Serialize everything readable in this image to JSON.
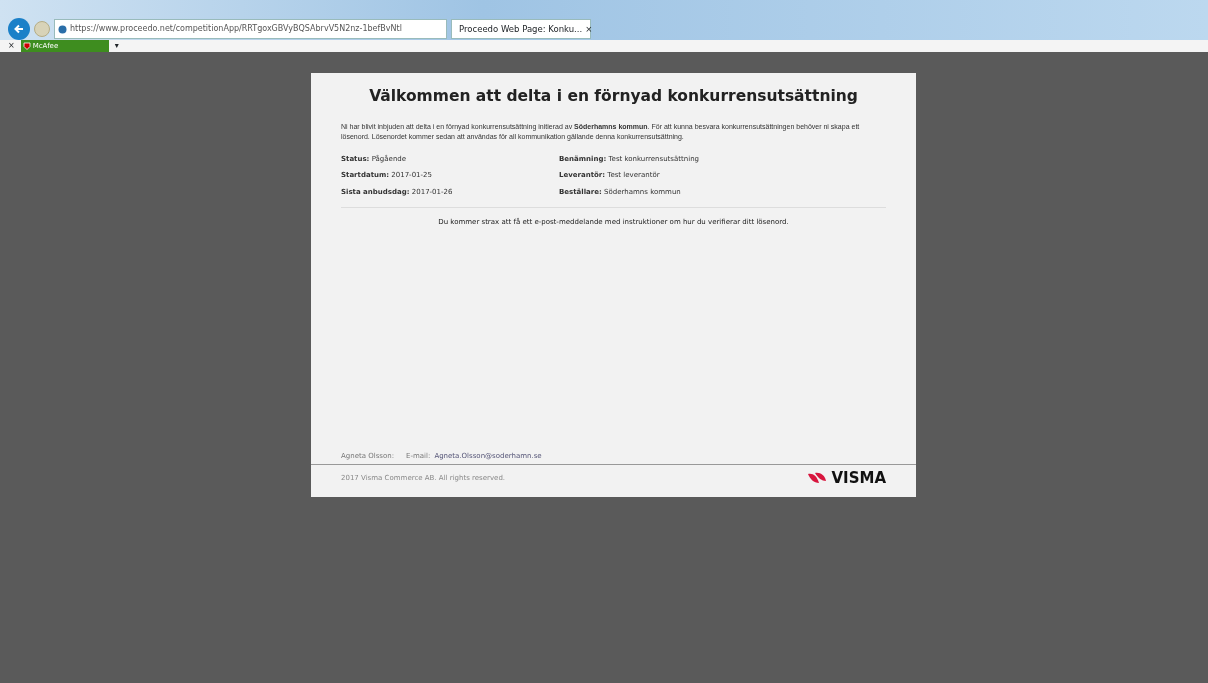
{
  "browser": {
    "url": "https://www.proceedo.net/competitionApp/RRTgoxGBVyBQSAbrvV5N2nz-1befBvNtl",
    "tab_title": "Proceedo Web Page: Konku...",
    "tab_close": "×",
    "toolbar_close": "×",
    "mcafee_label": "McAfee",
    "dropdown": "▾"
  },
  "page": {
    "title": "Välkommen att delta i en förnyad konkurrensutsättning",
    "intro": "Ni har blivit inbjuden att delta i en förnyad konkurrensutsättning initierad av **Söderhamns kommun**. För att kunna besvara konkurrensutsättningen behöver ni skapa ett lösenord. Lösenordet kommer sedan att användas för all kommunikation gällande denna konkurrensutsättning.",
    "fields_left": [
      {
        "label": "Status:",
        "value": "Pågående"
      },
      {
        "label": "Startdatum:",
        "value": "2017-01-25"
      },
      {
        "label": "Sista anbudsdag:",
        "value": "2017-01-26"
      }
    ],
    "fields_right": [
      {
        "label": "Benämning:",
        "value": "Test konkurrensutsättning"
      },
      {
        "label": "Leverantör:",
        "value": "Test leverantör"
      },
      {
        "label": "Beställare:",
        "value": "Söderhamns kommun"
      }
    ],
    "notice": "Du kommer strax att få ett e-post-meddelande med instruktioner om hur du verifierar ditt lösenord.",
    "contact_name": "Agneta Olsson:",
    "email_label": "E-mail:",
    "email": "Agneta.Olsson@soderhamn.se",
    "copyright": "2017 Visma Commerce AB. All rights reserved.",
    "logo_text": "VISMA"
  }
}
